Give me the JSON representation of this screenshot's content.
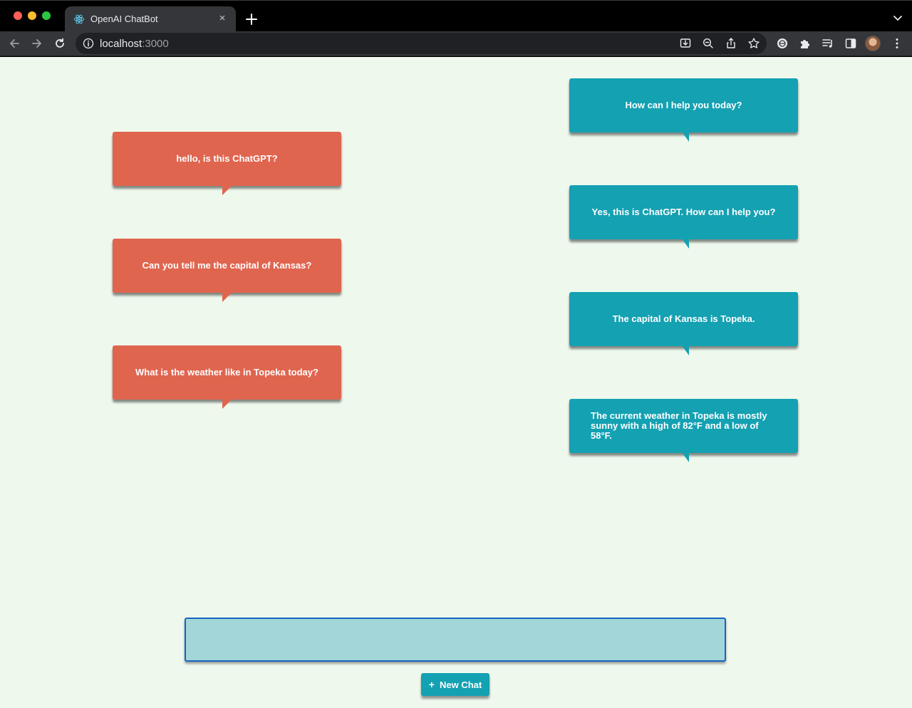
{
  "browser": {
    "tab_title": "OpenAI ChatBot",
    "tab_close_glyph": "×",
    "url_host": "localhost",
    "url_port": ":3000"
  },
  "conversation": {
    "user_messages": [
      "hello, is this ChatGPT?",
      "Can you tell me the capital of Kansas?",
      "What is the weather like in Topeka today?"
    ],
    "bot_messages": [
      "How can I help you today?",
      "Yes, this is ChatGPT. How can I help you?",
      "The capital of Kansas is Topeka.",
      "The current weather in Topeka is mostly sunny with a high of 82°F and a low of 58°F."
    ]
  },
  "composer": {
    "input_value": "",
    "new_chat_icon": "+",
    "new_chat_label": "New Chat"
  },
  "colors": {
    "page_background": "#eef8ed",
    "user_bubble": "#e0654f",
    "bot_bubble": "#14a1b2",
    "input_background": "#a2d6d8",
    "input_border": "#1764c0"
  }
}
